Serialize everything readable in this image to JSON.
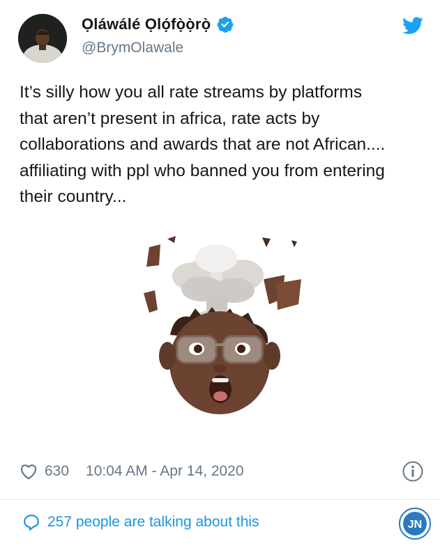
{
  "author": {
    "display_name": "Ọláwálé Ọlọ́fọ̀ọ̀rọ̀",
    "handle": "@BrymOlawale",
    "verified": true
  },
  "tweet": {
    "text": "It’s silly how you all rate streams by platforms\nthat aren’t present in africa, rate acts by\ncollaborations and awards that are not African....\naffiliating with ppl who banned you from entering\ntheir country...",
    "media_icon": "mind-blown-memoji"
  },
  "meta": {
    "like_count": "630",
    "timestamp": "10:04 AM - Apr 14, 2020"
  },
  "conversation": {
    "label": "257 people are talking about this"
  },
  "watermark": {
    "text": "JN"
  },
  "colors": {
    "brand_blue": "#1da1f2",
    "link_blue": "#1b95e0",
    "secondary_text": "#657786",
    "divider": "#e1e8ed"
  }
}
